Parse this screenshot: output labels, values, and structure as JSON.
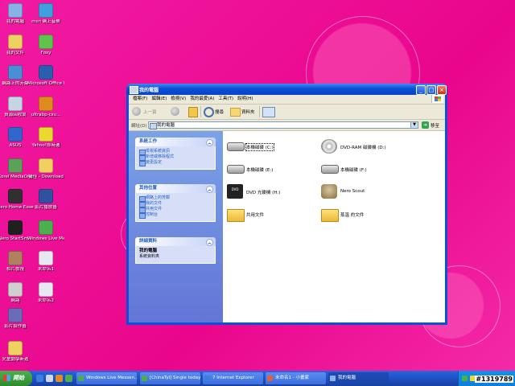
{
  "desktop": {
    "icons": [
      {
        "label": "我的電腦",
        "icon": "my-computer-icon",
        "color": "#8ab0e8"
      },
      {
        "label": "msn 網上音樂",
        "icon": "msn-music-icon",
        "color": "#3ea0e0"
      },
      {
        "label": "我的文件",
        "icon": "my-documents-icon",
        "color": "#f0d060"
      },
      {
        "label": "Foxy",
        "icon": "foxy-icon",
        "color": "#5fc44c"
      },
      {
        "label": "網路上的芳鄰",
        "icon": "network-places-icon",
        "color": "#4a8ed6"
      },
      {
        "label": "Microsoft Office Wo...",
        "icon": "word-icon",
        "color": "#2a5fb0"
      },
      {
        "label": "資源回收筒",
        "icon": "recycle-bin-icon",
        "color": "#c6d4e4"
      },
      {
        "label": "ultrabp-csu...",
        "icon": "windows-media-icon",
        "color": "#e08a20"
      },
      {
        "label": "ASUS",
        "icon": "asus-icon",
        "color": "#3366cc"
      },
      {
        "label": "Yahoo!即時通",
        "icon": "yahoo-messenger-icon",
        "color": "#e8d830"
      },
      {
        "label": "Corel MediaOne",
        "icon": "corel-icon",
        "color": "#5da05a"
      },
      {
        "label": "捷徑 - Download",
        "icon": "folder-shortcut-icon",
        "color": "#f0d060"
      },
      {
        "label": "Nero Home Essentials SE",
        "icon": "nero-home-icon",
        "color": "#303030"
      },
      {
        "label": "影片播放器",
        "icon": "video-player-icon",
        "color": "#3050a0"
      },
      {
        "label": "Nero StartSm...",
        "icon": "nero-start-icon",
        "color": "#202020"
      },
      {
        "label": "Windows Live Messenger",
        "icon": "live-messenger-icon",
        "color": "#4cae4c"
      },
      {
        "label": "相片檢視",
        "icon": "photo-viewer-icon",
        "color": "#b08060"
      },
      {
        "label": "未命名1",
        "icon": "document-icon",
        "color": "#e8e8f0"
      },
      {
        "label": "網路",
        "icon": "webcam-icon",
        "color": "#d0d0d0"
      },
      {
        "label": "未命名2",
        "icon": "document-icon",
        "color": "#e8e8f0"
      },
      {
        "label": "影片製作器",
        "icon": "movie-maker-icon",
        "color": "#6b6bb8"
      },
      {
        "label": "兒童動學新遊",
        "icon": "folder-icon",
        "color": "#f0d060"
      }
    ]
  },
  "window": {
    "title": "我的電腦",
    "menu": [
      "檔案(F)",
      "編輯(E)",
      "檢視(V)",
      "我的最愛(A)",
      "工具(T)",
      "說明(H)"
    ],
    "toolbar": {
      "back": "上一頁",
      "search": "搜尋",
      "folders": "資料夾"
    },
    "address": {
      "label": "網址(D)",
      "value": "我的電腦",
      "go": "移至"
    },
    "panels": [
      {
        "title": "系統工作",
        "items": [
          "檢視系統資訊",
          "新增或移除程式",
          "變更設定"
        ]
      },
      {
        "title": "其他位置",
        "items": [
          "網路上的芳鄰",
          "我的文件",
          "共用文件",
          "控制台"
        ]
      }
    ],
    "details": {
      "title": "詳細資料",
      "name": "我的電腦",
      "desc": "系統資料夾"
    },
    "items": [
      {
        "label": "本機磁碟 (C:)",
        "kind": "drive",
        "selected": true
      },
      {
        "label": "DVD-RAM 磁碟機 (D:)",
        "kind": "disc"
      },
      {
        "label": "本機磁碟 (E:)",
        "kind": "drive"
      },
      {
        "label": "本機磁碟 (F:)",
        "kind": "drive"
      },
      {
        "label": "DVD 光碟機 (H:)",
        "kind": "dvd"
      },
      {
        "label": "Nero Scout",
        "kind": "nero"
      },
      {
        "label": "共用文件",
        "kind": "folder"
      },
      {
        "label": "蒸溫 的文件",
        "kind": "folder"
      }
    ]
  },
  "taskbar": {
    "start": "開始",
    "tasks": [
      {
        "label": "Windows Live Messen...",
        "color": "#4cae4c"
      },
      {
        "label": "[ChinaTyl] Single today...",
        "color": "#4cae4c"
      },
      {
        "label": "7 Internet Explorer",
        "color": "#3a7ee0"
      },
      {
        "label": "未命名1 - 小畫家",
        "color": "#e06040"
      },
      {
        "label": "我的電腦",
        "color": "#8ab0e8",
        "active": true
      }
    ],
    "clock": "#1319789"
  }
}
